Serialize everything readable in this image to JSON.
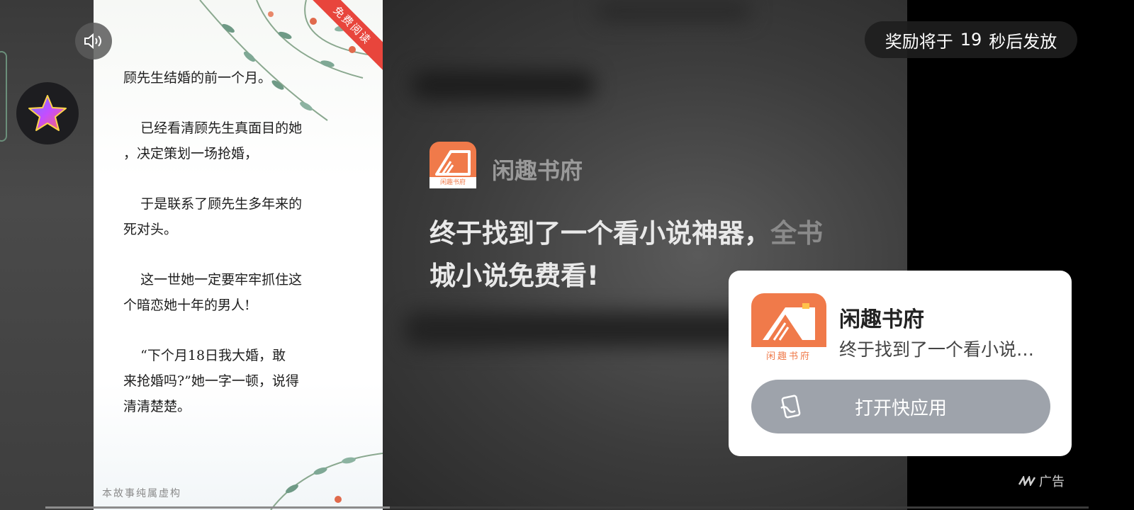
{
  "reward": {
    "prefix": "奖励将于",
    "seconds": "19",
    "suffix": "秒后发放"
  },
  "story": {
    "ribbon": "免费阅读",
    "paragraphs": [
      [
        "顾先生结婚的前一个月。"
      ],
      [
        "    已经看清顾先生真面目的她",
        "，决定策划一场抢婚，"
      ],
      [
        "    于是联系了顾先生多年来的",
        "死对头。"
      ],
      [
        "    这一世她一定要牢牢抓住这",
        "个暗恋她十年的男人!"
      ],
      [
        "    “下个月18日我大婚，敢",
        "来抢婚吗?”她一字一顿，说得",
        "清清楚楚。"
      ]
    ],
    "disclaimer": "本故事纯属虚构"
  },
  "ad": {
    "app_name": "闲趣书府",
    "icon_caption": "闲趣书府",
    "headline_main": "终于找到了一个看小说神器，",
    "headline_fade": "全书",
    "headline_line2": "城小说免费看!",
    "brand_color": "#f07a4a"
  },
  "card": {
    "title": "闲趣书府",
    "description": "终于找到了一个看小说神器，全书城小说免费看!",
    "button_label": "打开快应用",
    "icon_caption": "闲趣书府"
  },
  "ad_tag": "广告",
  "progress": {
    "fraction": 0.33
  }
}
